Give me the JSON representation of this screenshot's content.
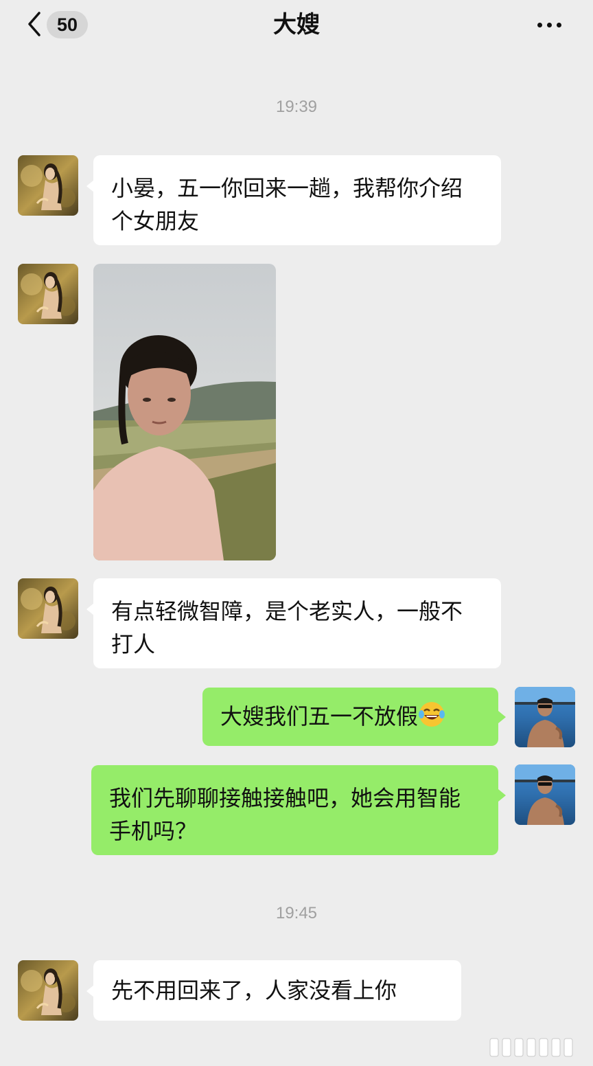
{
  "header": {
    "title": "大嫂",
    "unread_count": "50",
    "back_icon": "chevron-left-icon",
    "more_icon": "more-dots-icon"
  },
  "timestamps": [
    "19:39",
    "19:45"
  ],
  "messages": [
    {
      "from": "大嫂",
      "type": "text",
      "text": "小晏，五一你回来一趟，我帮你介绍个女朋友"
    },
    {
      "from": "大嫂",
      "type": "image"
    },
    {
      "from": "大嫂",
      "type": "text",
      "text": "有点轻微智障，是个老实人，一般不打人"
    },
    {
      "from": "me",
      "type": "text",
      "text": "大嫂我们五一不放假",
      "emoji": "laughing-tears-emoji"
    },
    {
      "from": "me",
      "type": "text",
      "text": "我们先聊聊接触接触吧，她会用智能手机吗？"
    },
    {
      "from": "大嫂",
      "type": "text",
      "text": "先不用回来了，人家没看上你"
    }
  ],
  "colors": {
    "background": "#ededed",
    "incoming_bubble": "#ffffff",
    "outgoing_bubble": "#95ec69",
    "timestamp": "#a0a0a0"
  }
}
